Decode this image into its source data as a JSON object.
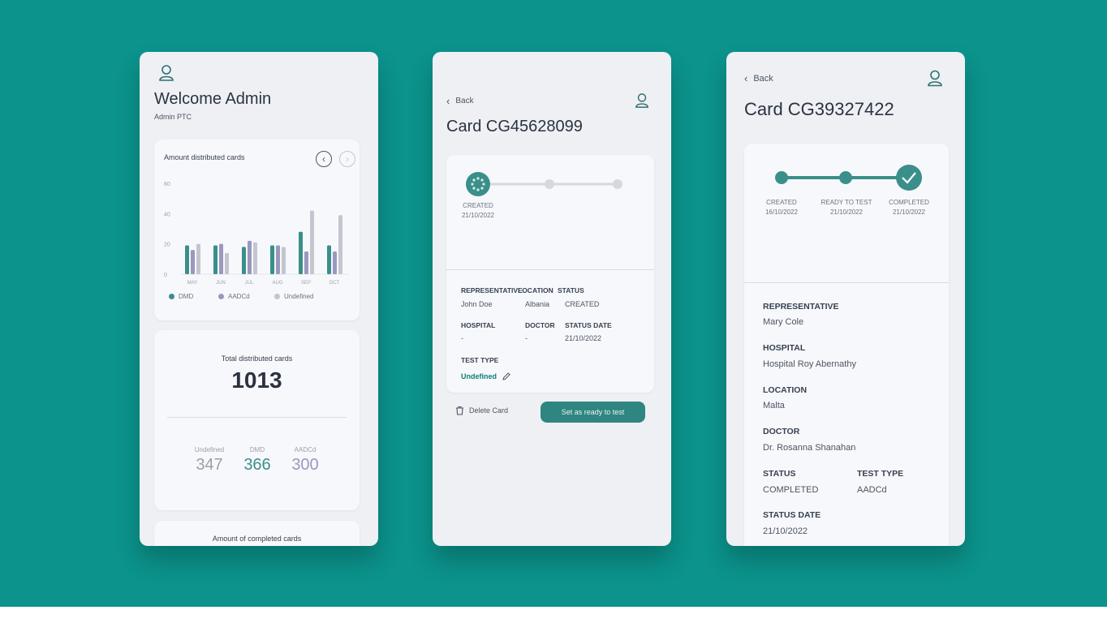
{
  "colors": {
    "background": "#0b938c",
    "accent": "#3a8f8a",
    "series_dmd": "#3a8f8a",
    "series_aadcd": "#9a98bd",
    "series_undefined": "#c3c6cf"
  },
  "dashboard": {
    "profile_icon": "user-icon",
    "welcome": "Welcome Admin",
    "subtitle": "Admin PTC",
    "chart_card": {
      "prev_icon": "chevron-left-icon",
      "next_icon": "chevron-right-icon"
    },
    "total": {
      "title": "Total distributed cards",
      "value": "1013",
      "stats": [
        {
          "label": "Undefined",
          "value": "347"
        },
        {
          "label": "DMD",
          "value": "366"
        },
        {
          "label": "AADCd",
          "value": "300"
        }
      ]
    },
    "completed_title": "Amount of completed cards"
  },
  "chart_data": {
    "type": "bar",
    "title": "Amount distributed cards",
    "categories": [
      "MAY",
      "JUN",
      "JUL",
      "AUG",
      "SEP",
      "OCT"
    ],
    "ylim": [
      0,
      60
    ],
    "yticks": [
      0,
      20,
      40,
      60
    ],
    "series": [
      {
        "name": "DMD",
        "values": [
          19,
          19,
          18,
          19,
          28,
          19
        ]
      },
      {
        "name": "AADCd",
        "values": [
          16,
          20,
          22,
          19,
          15,
          15
        ]
      },
      {
        "name": "Undefined",
        "values": [
          20,
          14,
          21,
          18,
          42,
          39
        ]
      }
    ],
    "legend_position": "bottom",
    "grid": false
  },
  "card_detail": {
    "back_label": "Back",
    "title": "Card CG45628099",
    "steps": [
      {
        "label": "CREATED",
        "date": "21/10/2022"
      }
    ],
    "fields": {
      "representative_label": "REPRESENTATIVE",
      "location_label": "LOCATION",
      "status_label": "STATUS",
      "representative": "John Doe",
      "location": "Albania",
      "status": "CREATED",
      "hospital_label": "HOSPITAL",
      "doctor_label": "DOCTOR",
      "status_date_label": "STATUS DATE",
      "hospital": "-",
      "doctor": "-",
      "status_date": "21/10/2022",
      "test_type_label": "TEST TYPE",
      "test_type": "Undefined"
    },
    "delete_label": "Delete Card",
    "primary_label": "Set as ready to test"
  },
  "card_completed": {
    "back_label": "Back",
    "title": "Card CG39327422",
    "steps": [
      {
        "label": "CREATED",
        "date": "16/10/2022"
      },
      {
        "label": "READY TO TEST",
        "date": "21/10/2022"
      },
      {
        "label": "COMPLETED",
        "date": "21/10/2022"
      }
    ],
    "fields": {
      "representative_label": "REPRESENTATIVE",
      "representative": "Mary Cole",
      "hospital_label": "HOSPITAL",
      "hospital": "Hospital Roy Abernathy",
      "location_label": "LOCATION",
      "location": "Malta",
      "doctor_label": "DOCTOR",
      "doctor": "Dr. Rosanna Shanahan",
      "status_label": "STATUS",
      "status": "COMPLETED",
      "test_type_label": "TEST TYPE",
      "test_type": "AADCd",
      "status_date_label": "STATUS DATE",
      "status_date": "21/10/2022"
    }
  }
}
